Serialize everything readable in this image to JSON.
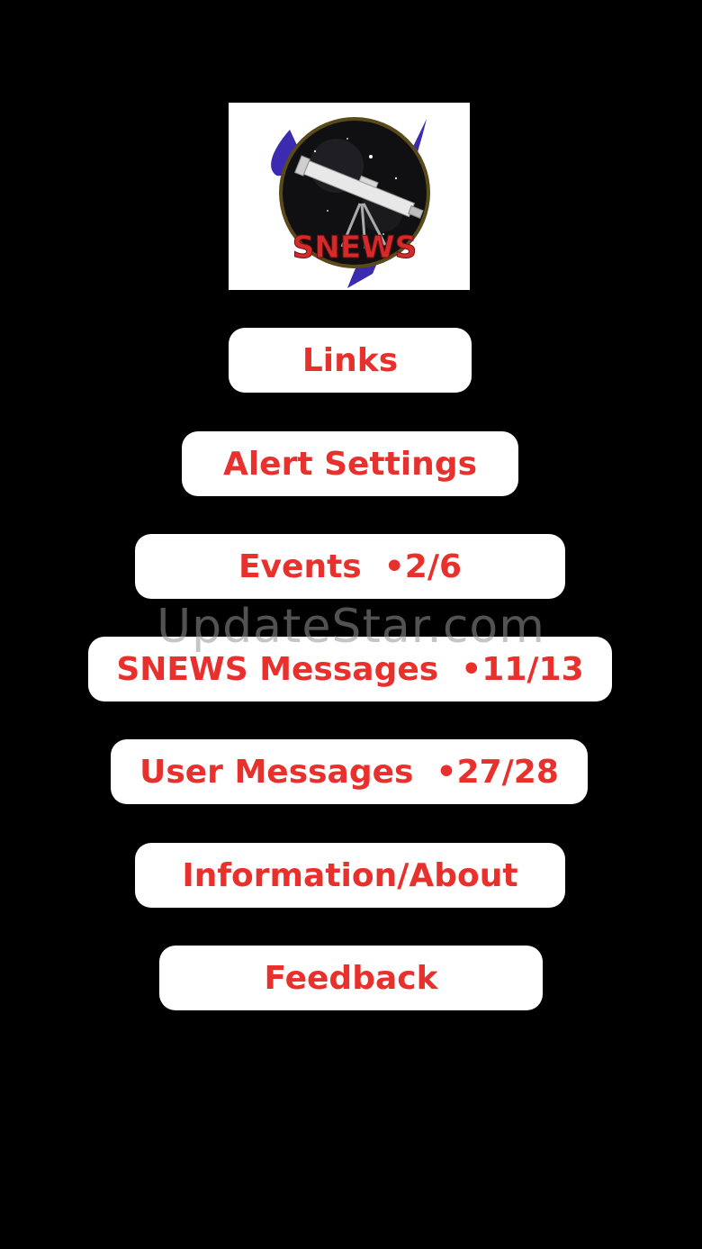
{
  "logo": {
    "text": "SNEWS",
    "icon": "telescope-icon"
  },
  "menu": {
    "links": "Links",
    "alert_settings": "Alert Settings",
    "events": "Events  •2/6",
    "snews_messages": "SNEWS Messages  •11/13",
    "user_messages": "User Messages  •27/28",
    "information_about": "Information/About",
    "feedback": "Feedback"
  },
  "watermark": "UpdateStar.com",
  "colors": {
    "background": "#000000",
    "button_bg": "#ffffff",
    "button_text": "#e8302c",
    "logo_text": "#d62a2a",
    "logo_swoosh": "#3b2bb0"
  }
}
